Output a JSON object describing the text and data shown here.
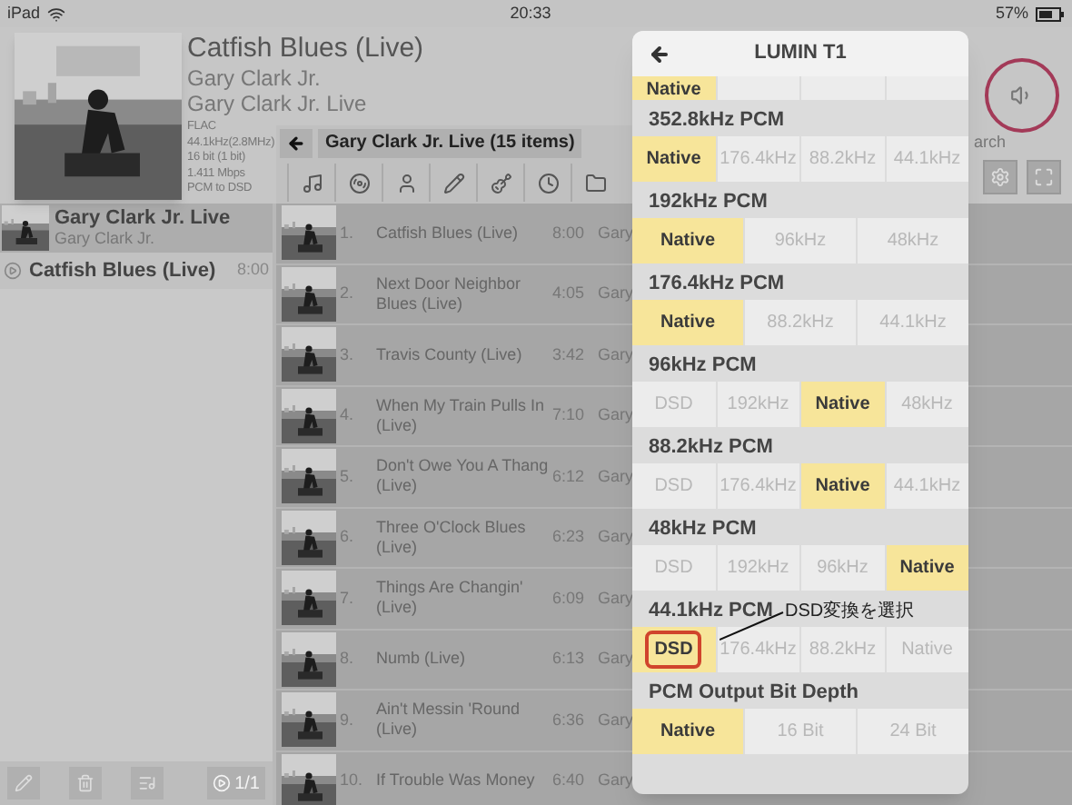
{
  "status_bar": {
    "device": "iPad",
    "time": "20:33",
    "battery": "57%"
  },
  "now_playing": {
    "title": "Catfish Blues (Live)",
    "artist": "Gary Clark Jr.",
    "album": "Gary Clark Jr. Live",
    "format": [
      "FLAC",
      "44.1kHz(2.8MHz)",
      "16 bit (1 bit)",
      "1.411 Mbps",
      "PCM to DSD"
    ]
  },
  "breadcrumb": "Gary Clark Jr. Live (15 items)",
  "search_hint": "arch",
  "queue": {
    "album": "Gary Clark Jr. Live",
    "artist": "Gary Clark Jr.",
    "tracks": [
      {
        "title": "Catfish Blues (Live)",
        "time": "8:00"
      }
    ],
    "counter": "1/1"
  },
  "tracks": [
    {
      "number": "1.",
      "title": "Catfish Blues (Live)",
      "time": "8:00",
      "artist": "Gary"
    },
    {
      "number": "2.",
      "title": "Next Door Neighbor Blues (Live)",
      "time": "4:05",
      "artist": "Gary"
    },
    {
      "number": "3.",
      "title": "Travis County (Live)",
      "time": "3:42",
      "artist": "Gary"
    },
    {
      "number": "4.",
      "title": "When My Train Pulls In (Live)",
      "time": "7:10",
      "artist": "Gary"
    },
    {
      "number": "5.",
      "title": "Don't Owe You A Thang (Live)",
      "time": "6:12",
      "artist": "Gary"
    },
    {
      "number": "6.",
      "title": "Three O'Clock Blues (Live)",
      "time": "6:23",
      "artist": "Gary"
    },
    {
      "number": "7.",
      "title": "Things Are Changin' (Live)",
      "time": "6:09",
      "artist": "Gary"
    },
    {
      "number": "8.",
      "title": "Numb (Live)",
      "time": "6:13",
      "artist": "Gary"
    },
    {
      "number": "9.",
      "title": "Ain't Messin 'Round (Live)",
      "time": "6:36",
      "artist": "Gary"
    },
    {
      "number": "10.",
      "title": "If Trouble Was Money",
      "time": "6:40",
      "artist": "Gary"
    }
  ],
  "popover": {
    "title": "LUMIN T1",
    "partial_row": [
      {
        "label": "Native",
        "selected": true
      },
      {
        "selected": false
      },
      {
        "selected": false
      },
      {
        "selected": false
      }
    ],
    "sections": [
      {
        "label": "352.8kHz PCM",
        "options": [
          {
            "label": "Native",
            "selected": true
          },
          {
            "label": "176.4kHz",
            "selected": false
          },
          {
            "label": "88.2kHz",
            "selected": false
          },
          {
            "label": "44.1kHz",
            "selected": false
          }
        ]
      },
      {
        "label": "192kHz PCM",
        "options": [
          {
            "label": "Native",
            "selected": true
          },
          {
            "label": "96kHz",
            "selected": false
          },
          {
            "label": "48kHz",
            "selected": false
          }
        ]
      },
      {
        "label": "176.4kHz PCM",
        "options": [
          {
            "label": "Native",
            "selected": true
          },
          {
            "label": "88.2kHz",
            "selected": false
          },
          {
            "label": "44.1kHz",
            "selected": false
          }
        ]
      },
      {
        "label": "96kHz PCM",
        "options": [
          {
            "label": "DSD",
            "selected": false
          },
          {
            "label": "192kHz",
            "selected": false
          },
          {
            "label": "Native",
            "selected": true
          },
          {
            "label": "48kHz",
            "selected": false
          }
        ]
      },
      {
        "label": "88.2kHz PCM",
        "options": [
          {
            "label": "DSD",
            "selected": false
          },
          {
            "label": "176.4kHz",
            "selected": false
          },
          {
            "label": "Native",
            "selected": true
          },
          {
            "label": "44.1kHz",
            "selected": false
          }
        ]
      },
      {
        "label": "48kHz PCM",
        "options": [
          {
            "label": "DSD",
            "selected": false
          },
          {
            "label": "192kHz",
            "selected": false
          },
          {
            "label": "96kHz",
            "selected": false
          },
          {
            "label": "Native",
            "selected": true
          }
        ]
      },
      {
        "label": "44.1kHz PCM",
        "annotation": "DSD変換を選択",
        "options": [
          {
            "label": "DSD",
            "selected": true,
            "outlined": true
          },
          {
            "label": "176.4kHz",
            "selected": false
          },
          {
            "label": "88.2kHz",
            "selected": false
          },
          {
            "label": "Native",
            "selected": false
          }
        ]
      },
      {
        "label": "PCM Output Bit Depth",
        "options": [
          {
            "label": "Native",
            "selected": true
          },
          {
            "label": "16 Bit",
            "selected": false
          },
          {
            "label": "24 Bit",
            "selected": false
          }
        ]
      }
    ]
  }
}
